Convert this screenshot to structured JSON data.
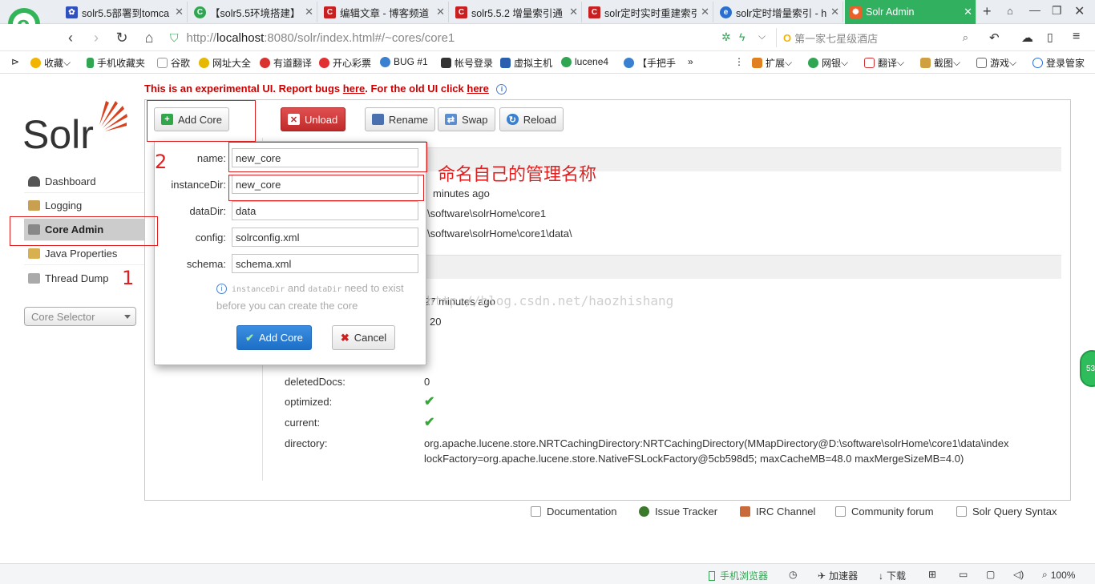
{
  "browser": {
    "tabs": [
      {
        "title": "solr5.5部署到tomca",
        "color": "#3050c0"
      },
      {
        "title": "【solr5.5环境搭建】",
        "color": "#31a652"
      },
      {
        "title": "编辑文章 - 博客频道",
        "color": "#c82020"
      },
      {
        "title": "solr5.5.2 增量索引通",
        "color": "#c82020"
      },
      {
        "title": "solr定时实时重建索引",
        "color": "#c82020"
      },
      {
        "title": "solr定时增量索引 - h",
        "color": "#2a6fd0"
      },
      {
        "title": "Solr Admin",
        "color": "#e8602a"
      }
    ],
    "url_prefix": "http://",
    "url_host": "localhost",
    "url_rest": ":8080/solr/index.html#/~cores/core1",
    "search_placeholder": "第一家七星级酒店",
    "bookmarks": [
      "收藏",
      "手机收藏夹",
      "谷歌",
      "网址大全",
      "有道翻译",
      "开心彩票",
      "BUG #1",
      "帐号登录",
      "虚拟主机",
      "lucene4",
      "【手把手",
      "»"
    ],
    "bookmarks_right": [
      "扩展",
      "网银",
      "翻译",
      "截图",
      "游戏",
      "登录管家"
    ],
    "status": {
      "mobile": "手机浏览器",
      "accelerator": "加速器",
      "download": "下载",
      "zoom": "100%"
    },
    "side_badge": "53"
  },
  "banner": {
    "text1": "This is an experimental UI. Report bugs ",
    "link1": "here",
    "text2": ". For the old UI click ",
    "link2": "here"
  },
  "logo": {
    "text": "Solr"
  },
  "nav": [
    {
      "label": "Dashboard",
      "color": "#555"
    },
    {
      "label": "Logging",
      "color": "#c9a050"
    },
    {
      "label": "Core Admin",
      "color": "#888"
    },
    {
      "label": "Java Properties",
      "color": "#d8b050"
    },
    {
      "label": "Thread Dump",
      "color": "#aaa"
    }
  ],
  "core_selector": {
    "placeholder": "Core Selector"
  },
  "toolbar": {
    "add_core": "Add Core",
    "unload": "Unload",
    "rename": "Rename",
    "swap": "Swap",
    "reload": "Reload"
  },
  "modal": {
    "fields": [
      {
        "label": "name:",
        "value": "new_core"
      },
      {
        "label": "instanceDir:",
        "value": "new_core"
      },
      {
        "label": "dataDir:",
        "value": "data"
      },
      {
        "label": "config:",
        "value": "solrconfig.xml"
      },
      {
        "label": "schema:",
        "value": "schema.xml"
      }
    ],
    "hint_code1": "instanceDir",
    "hint_and": " and ",
    "hint_code2": "dataDir",
    "hint_text": " need to exist before you can create the core",
    "submit": "Add Core",
    "cancel": "Cancel"
  },
  "core": {
    "start_time": "minutes ago",
    "instance_dir": "D:\\software\\solrHome\\core1",
    "data_dir": "D:\\software\\solrHome\\core1\\data\\",
    "last_modified": "27 minutes ago",
    "version": "20",
    "rows": [
      {
        "label": "deletedDocs:",
        "value": "0"
      },
      {
        "label": "optimized:",
        "value": "✔"
      },
      {
        "label": "current:",
        "value": "✔"
      },
      {
        "label": "directory:",
        "value": "org.apache.lucene.store.NRTCachingDirectory:NRTCachingDirectory(MMapDirectory@D:\\software\\solrHome\\core1\\data\\index"
      }
    ],
    "directory_line2": "lockFactory=org.apache.lucene.store.NativeFSLockFactory@5cb598d5; maxCacheMB=48.0 maxMergeSizeMB=4.0)"
  },
  "annotations": {
    "step1": "1",
    "step2": "2",
    "note": "命名自己的管理名称"
  },
  "watermark": "http://blog.csdn.net/haozhishang",
  "footer": [
    "Documentation",
    "Issue Tracker",
    "IRC Channel",
    "Community forum",
    "Solr Query Syntax"
  ]
}
